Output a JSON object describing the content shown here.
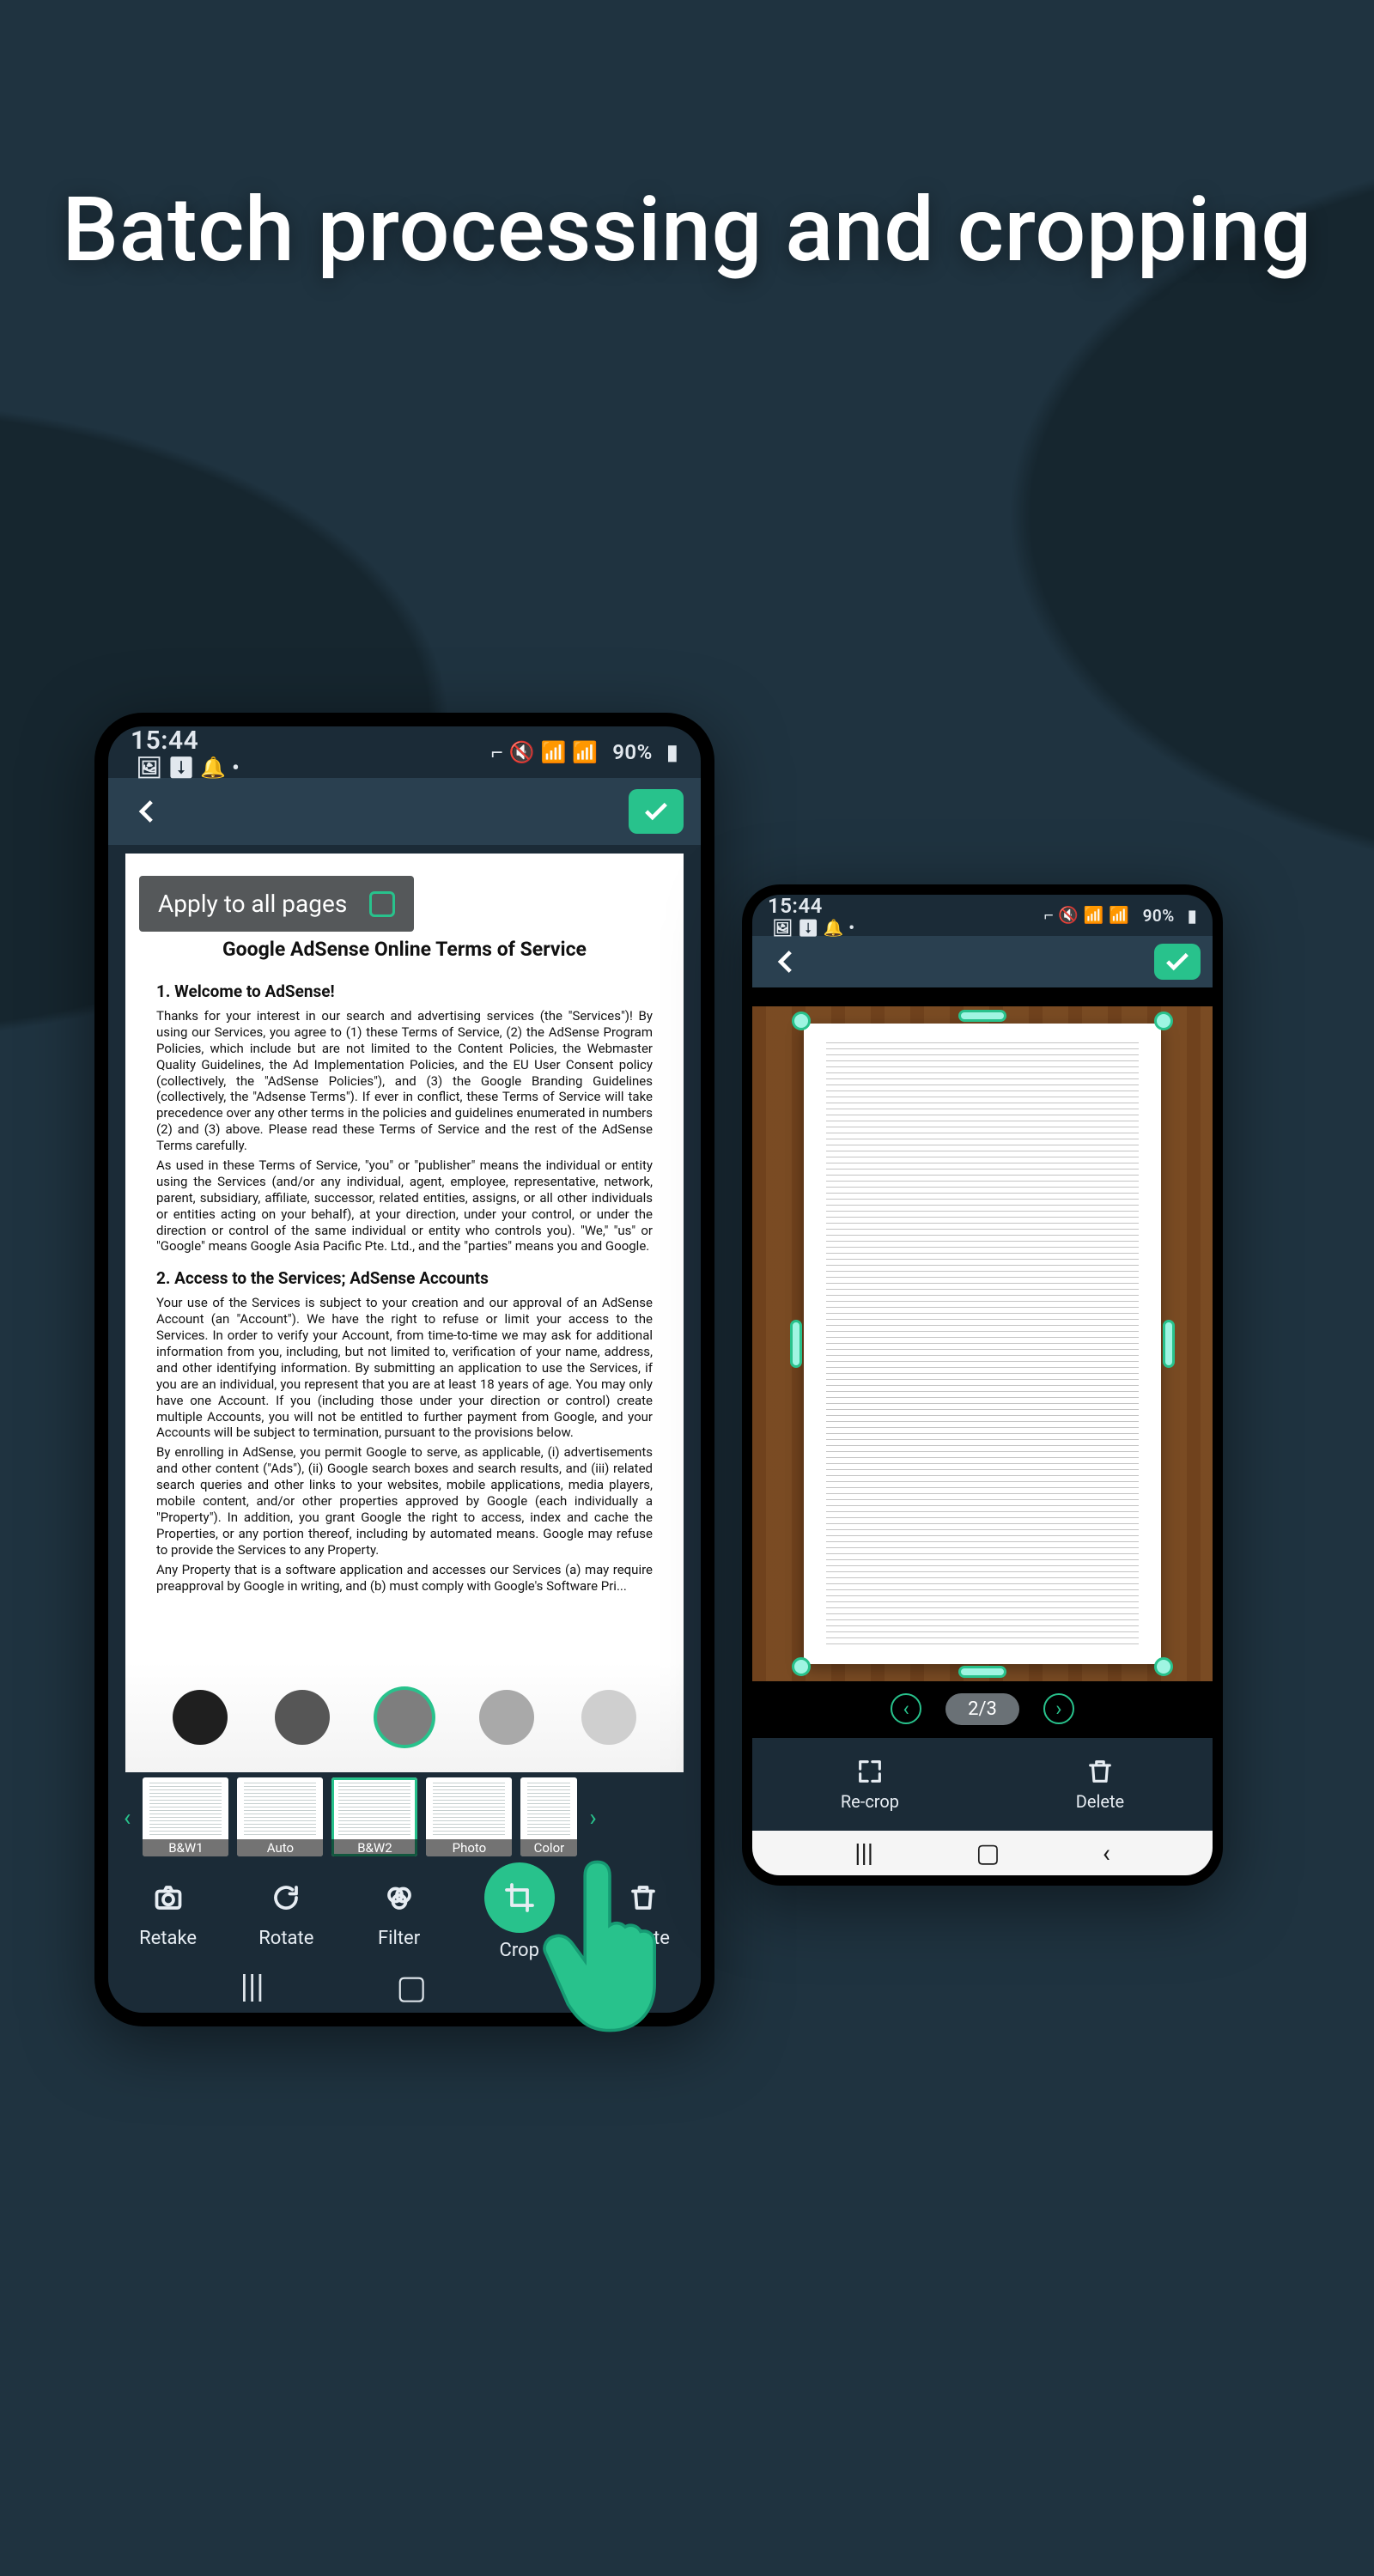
{
  "headline": "Batch processing and cropping",
  "phone1": {
    "status": {
      "time": "15:44",
      "battery": "90%"
    },
    "overlay_label": "Apply to all pages",
    "doc": {
      "title": "Google AdSense Online Terms of Service",
      "h1": "1.  Welcome to AdSense!",
      "p1": "Thanks for your interest in our search and advertising services (the \"Services\")! By using our Services, you agree to (1) these Terms of Service, (2) the AdSense Program Policies, which include but are not limited to the Content Policies, the Webmaster Quality Guidelines, the Ad Implementation Policies, and the EU User Consent policy (collectively, the \"AdSense Policies\"), and (3) the Google Branding Guidelines (collectively, the \"Adsense Terms\"). If ever in conflict, these Terms of Service will take precedence over any other terms in the policies and guidelines enumerated in numbers (2) and (3) above. Please read these Terms of Service and the rest of the AdSense Terms carefully.",
      "p1b": "As used in these Terms of Service, \"you\" or \"publisher\" means the individual or entity using the Services (and/or any individual, agent, employee, representative, network, parent, subsidiary, affiliate, successor, related entities, assigns, or all other individuals or entities acting on your behalf), at your direction, under your control, or under the direction or control of the same individual or entity who controls you). \"We,\" \"us\" or \"Google\" means Google Asia Pacific Pte. Ltd., and the \"parties\" means you and Google.",
      "h2": "2. Access to the Services; AdSense Accounts",
      "p2": "Your use of the Services is subject to your creation and our approval of an AdSense Account (an \"Account\"). We have the right to refuse or limit your access to the Services. In order to verify your Account, from time-to-time we may ask for additional information from you, including, but not limited to, verification of your name, address, and other identifying information. By submitting an application to use the Services, if you are an individual, you represent that you are at least 18 years of age. You may only have one Account. If you (including those under your direction or control) create multiple Accounts, you will not be entitled to further payment from Google, and your Accounts will be subject to termination, pursuant to the provisions below.",
      "p3": "By enrolling in AdSense, you permit Google to serve, as applicable, (i) advertisements and other content (\"Ads\"), (ii) Google search boxes and search results, and (iii) related search queries and other links to your websites, mobile applications, media players, mobile content, and/or other properties approved by Google (each individually a \"Property\"). In addition, you grant Google the right to access, index and cache the Properties, or any portion thereof, including by automated means. Google may refuse to provide the Services to any Property.",
      "p4": "Any Property that is a software application and accesses our Services (a) may require preapproval by Google in writing, and (b) must comply with Google's Software Pri..."
    },
    "filters": {
      "items": [
        "B&W1",
        "Auto",
        "B&W2",
        "Photo",
        "Color"
      ],
      "selected_index": 2
    },
    "tools": {
      "retake": "Retake",
      "rotate": "Rotate",
      "filter": "Filter",
      "crop": "Crop",
      "delete": "Delete"
    }
  },
  "phone2": {
    "status": {
      "time": "15:44",
      "battery": "90%"
    },
    "page_indicator": "2/3",
    "actions": {
      "recrop": "Re-crop",
      "delete": "Delete"
    }
  }
}
